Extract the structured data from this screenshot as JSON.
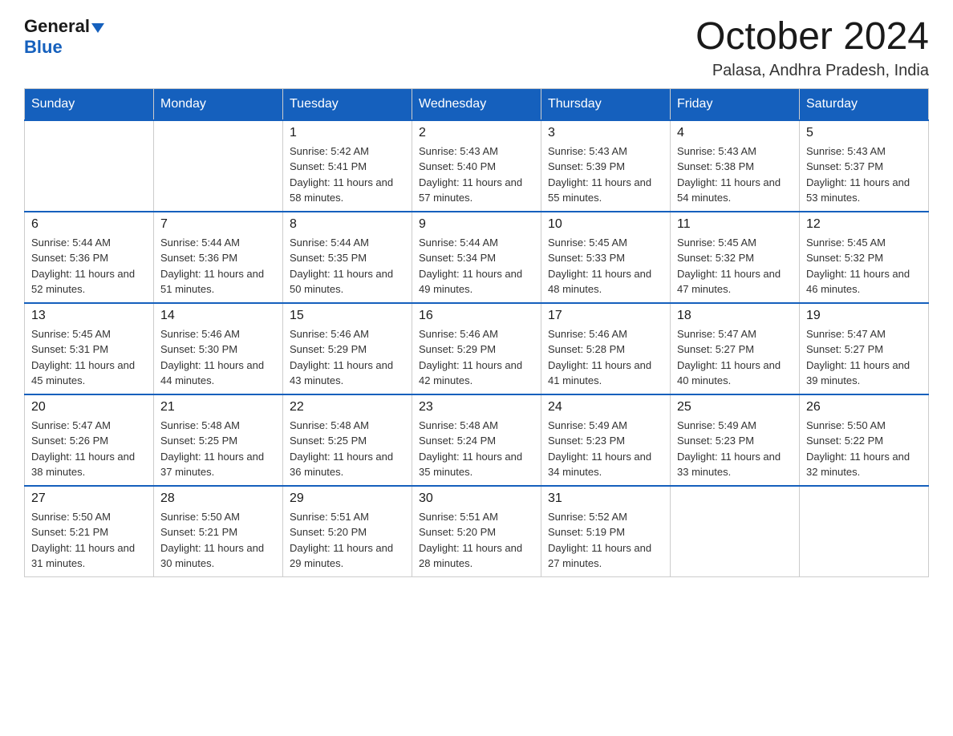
{
  "header": {
    "logo_general": "General",
    "logo_blue": "Blue",
    "month_title": "October 2024",
    "location": "Palasa, Andhra Pradesh, India"
  },
  "calendar": {
    "days_of_week": [
      "Sunday",
      "Monday",
      "Tuesday",
      "Wednesday",
      "Thursday",
      "Friday",
      "Saturday"
    ],
    "weeks": [
      [
        {
          "day": "",
          "sunrise": "",
          "sunset": "",
          "daylight": ""
        },
        {
          "day": "",
          "sunrise": "",
          "sunset": "",
          "daylight": ""
        },
        {
          "day": "1",
          "sunrise": "Sunrise: 5:42 AM",
          "sunset": "Sunset: 5:41 PM",
          "daylight": "Daylight: 11 hours and 58 minutes."
        },
        {
          "day": "2",
          "sunrise": "Sunrise: 5:43 AM",
          "sunset": "Sunset: 5:40 PM",
          "daylight": "Daylight: 11 hours and 57 minutes."
        },
        {
          "day": "3",
          "sunrise": "Sunrise: 5:43 AM",
          "sunset": "Sunset: 5:39 PM",
          "daylight": "Daylight: 11 hours and 55 minutes."
        },
        {
          "day": "4",
          "sunrise": "Sunrise: 5:43 AM",
          "sunset": "Sunset: 5:38 PM",
          "daylight": "Daylight: 11 hours and 54 minutes."
        },
        {
          "day": "5",
          "sunrise": "Sunrise: 5:43 AM",
          "sunset": "Sunset: 5:37 PM",
          "daylight": "Daylight: 11 hours and 53 minutes."
        }
      ],
      [
        {
          "day": "6",
          "sunrise": "Sunrise: 5:44 AM",
          "sunset": "Sunset: 5:36 PM",
          "daylight": "Daylight: 11 hours and 52 minutes."
        },
        {
          "day": "7",
          "sunrise": "Sunrise: 5:44 AM",
          "sunset": "Sunset: 5:36 PM",
          "daylight": "Daylight: 11 hours and 51 minutes."
        },
        {
          "day": "8",
          "sunrise": "Sunrise: 5:44 AM",
          "sunset": "Sunset: 5:35 PM",
          "daylight": "Daylight: 11 hours and 50 minutes."
        },
        {
          "day": "9",
          "sunrise": "Sunrise: 5:44 AM",
          "sunset": "Sunset: 5:34 PM",
          "daylight": "Daylight: 11 hours and 49 minutes."
        },
        {
          "day": "10",
          "sunrise": "Sunrise: 5:45 AM",
          "sunset": "Sunset: 5:33 PM",
          "daylight": "Daylight: 11 hours and 48 minutes."
        },
        {
          "day": "11",
          "sunrise": "Sunrise: 5:45 AM",
          "sunset": "Sunset: 5:32 PM",
          "daylight": "Daylight: 11 hours and 47 minutes."
        },
        {
          "day": "12",
          "sunrise": "Sunrise: 5:45 AM",
          "sunset": "Sunset: 5:32 PM",
          "daylight": "Daylight: 11 hours and 46 minutes."
        }
      ],
      [
        {
          "day": "13",
          "sunrise": "Sunrise: 5:45 AM",
          "sunset": "Sunset: 5:31 PM",
          "daylight": "Daylight: 11 hours and 45 minutes."
        },
        {
          "day": "14",
          "sunrise": "Sunrise: 5:46 AM",
          "sunset": "Sunset: 5:30 PM",
          "daylight": "Daylight: 11 hours and 44 minutes."
        },
        {
          "day": "15",
          "sunrise": "Sunrise: 5:46 AM",
          "sunset": "Sunset: 5:29 PM",
          "daylight": "Daylight: 11 hours and 43 minutes."
        },
        {
          "day": "16",
          "sunrise": "Sunrise: 5:46 AM",
          "sunset": "Sunset: 5:29 PM",
          "daylight": "Daylight: 11 hours and 42 minutes."
        },
        {
          "day": "17",
          "sunrise": "Sunrise: 5:46 AM",
          "sunset": "Sunset: 5:28 PM",
          "daylight": "Daylight: 11 hours and 41 minutes."
        },
        {
          "day": "18",
          "sunrise": "Sunrise: 5:47 AM",
          "sunset": "Sunset: 5:27 PM",
          "daylight": "Daylight: 11 hours and 40 minutes."
        },
        {
          "day": "19",
          "sunrise": "Sunrise: 5:47 AM",
          "sunset": "Sunset: 5:27 PM",
          "daylight": "Daylight: 11 hours and 39 minutes."
        }
      ],
      [
        {
          "day": "20",
          "sunrise": "Sunrise: 5:47 AM",
          "sunset": "Sunset: 5:26 PM",
          "daylight": "Daylight: 11 hours and 38 minutes."
        },
        {
          "day": "21",
          "sunrise": "Sunrise: 5:48 AM",
          "sunset": "Sunset: 5:25 PM",
          "daylight": "Daylight: 11 hours and 37 minutes."
        },
        {
          "day": "22",
          "sunrise": "Sunrise: 5:48 AM",
          "sunset": "Sunset: 5:25 PM",
          "daylight": "Daylight: 11 hours and 36 minutes."
        },
        {
          "day": "23",
          "sunrise": "Sunrise: 5:48 AM",
          "sunset": "Sunset: 5:24 PM",
          "daylight": "Daylight: 11 hours and 35 minutes."
        },
        {
          "day": "24",
          "sunrise": "Sunrise: 5:49 AM",
          "sunset": "Sunset: 5:23 PM",
          "daylight": "Daylight: 11 hours and 34 minutes."
        },
        {
          "day": "25",
          "sunrise": "Sunrise: 5:49 AM",
          "sunset": "Sunset: 5:23 PM",
          "daylight": "Daylight: 11 hours and 33 minutes."
        },
        {
          "day": "26",
          "sunrise": "Sunrise: 5:50 AM",
          "sunset": "Sunset: 5:22 PM",
          "daylight": "Daylight: 11 hours and 32 minutes."
        }
      ],
      [
        {
          "day": "27",
          "sunrise": "Sunrise: 5:50 AM",
          "sunset": "Sunset: 5:21 PM",
          "daylight": "Daylight: 11 hours and 31 minutes."
        },
        {
          "day": "28",
          "sunrise": "Sunrise: 5:50 AM",
          "sunset": "Sunset: 5:21 PM",
          "daylight": "Daylight: 11 hours and 30 minutes."
        },
        {
          "day": "29",
          "sunrise": "Sunrise: 5:51 AM",
          "sunset": "Sunset: 5:20 PM",
          "daylight": "Daylight: 11 hours and 29 minutes."
        },
        {
          "day": "30",
          "sunrise": "Sunrise: 5:51 AM",
          "sunset": "Sunset: 5:20 PM",
          "daylight": "Daylight: 11 hours and 28 minutes."
        },
        {
          "day": "31",
          "sunrise": "Sunrise: 5:52 AM",
          "sunset": "Sunset: 5:19 PM",
          "daylight": "Daylight: 11 hours and 27 minutes."
        },
        {
          "day": "",
          "sunrise": "",
          "sunset": "",
          "daylight": ""
        },
        {
          "day": "",
          "sunrise": "",
          "sunset": "",
          "daylight": ""
        }
      ]
    ]
  }
}
